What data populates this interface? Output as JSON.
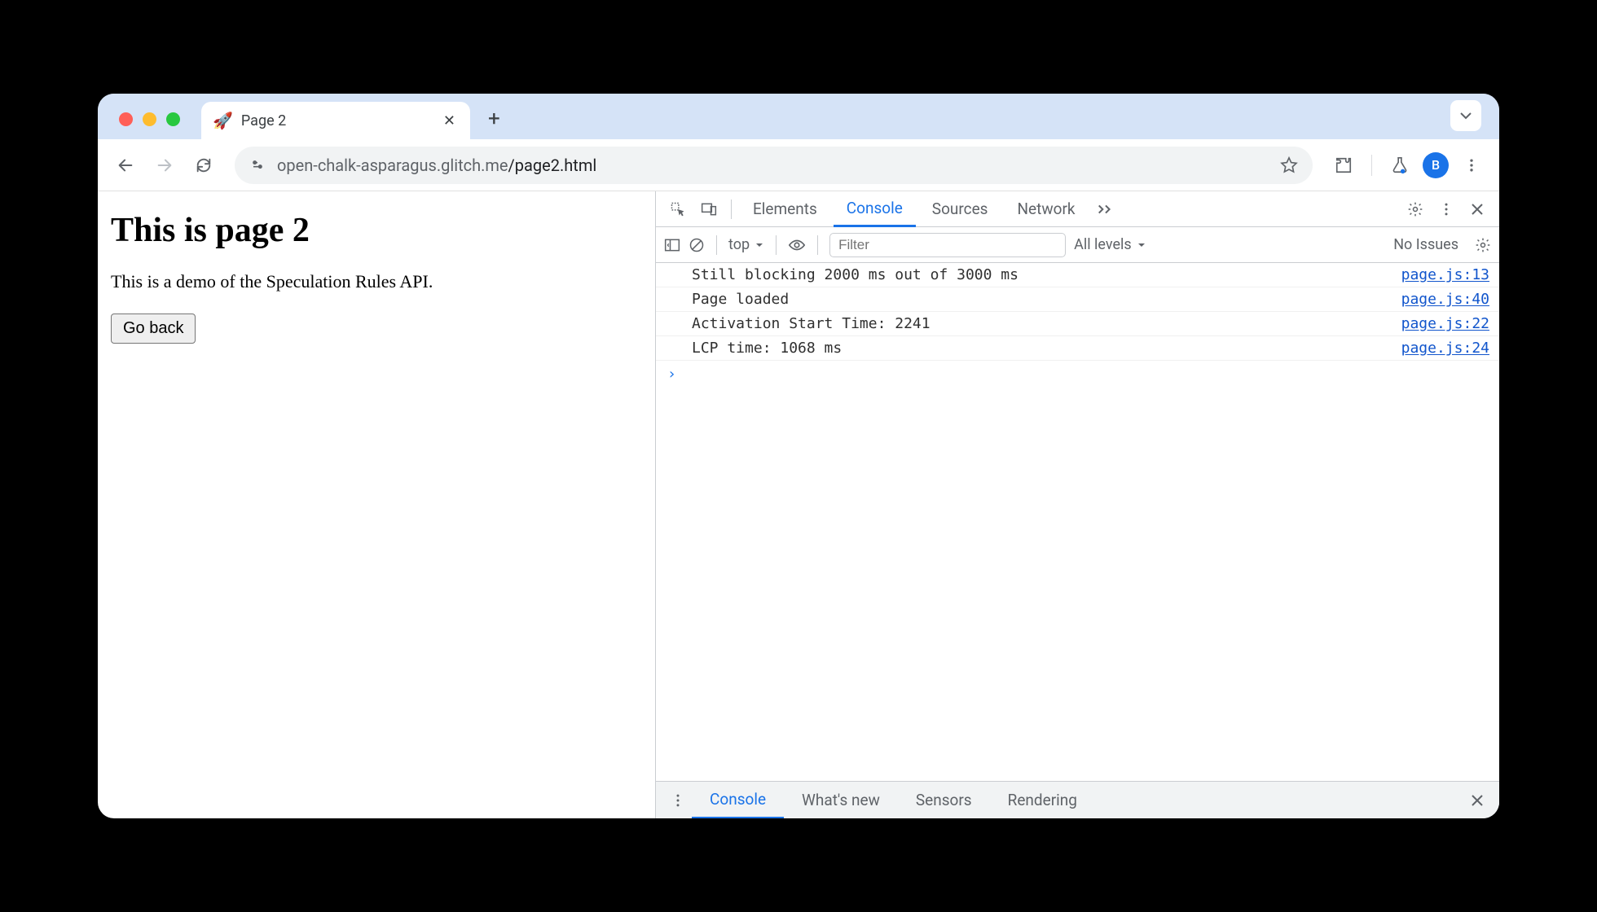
{
  "browser": {
    "tab_title": "Page 2",
    "url_host": "open-chalk-asparagus.glitch.me",
    "url_path": "/page2.html",
    "profile_initial": "B"
  },
  "page": {
    "heading": "This is page 2",
    "paragraph": "This is a demo of the Speculation Rules API.",
    "button_label": "Go back"
  },
  "devtools": {
    "tabs": [
      "Elements",
      "Console",
      "Sources",
      "Network"
    ],
    "active_tab": "Console",
    "context": "top",
    "filter_placeholder": "Filter",
    "levels_label": "All levels",
    "issues_label": "No Issues",
    "logs": [
      {
        "message": "Still blocking 2000 ms out of 3000 ms",
        "source": "page.js:13"
      },
      {
        "message": "Page loaded",
        "source": "page.js:40"
      },
      {
        "message": "Activation Start Time: 2241",
        "source": "page.js:22"
      },
      {
        "message": "LCP time: 1068 ms",
        "source": "page.js:24"
      }
    ],
    "drawer_tabs": [
      "Console",
      "What's new",
      "Sensors",
      "Rendering"
    ],
    "drawer_active": "Console"
  }
}
